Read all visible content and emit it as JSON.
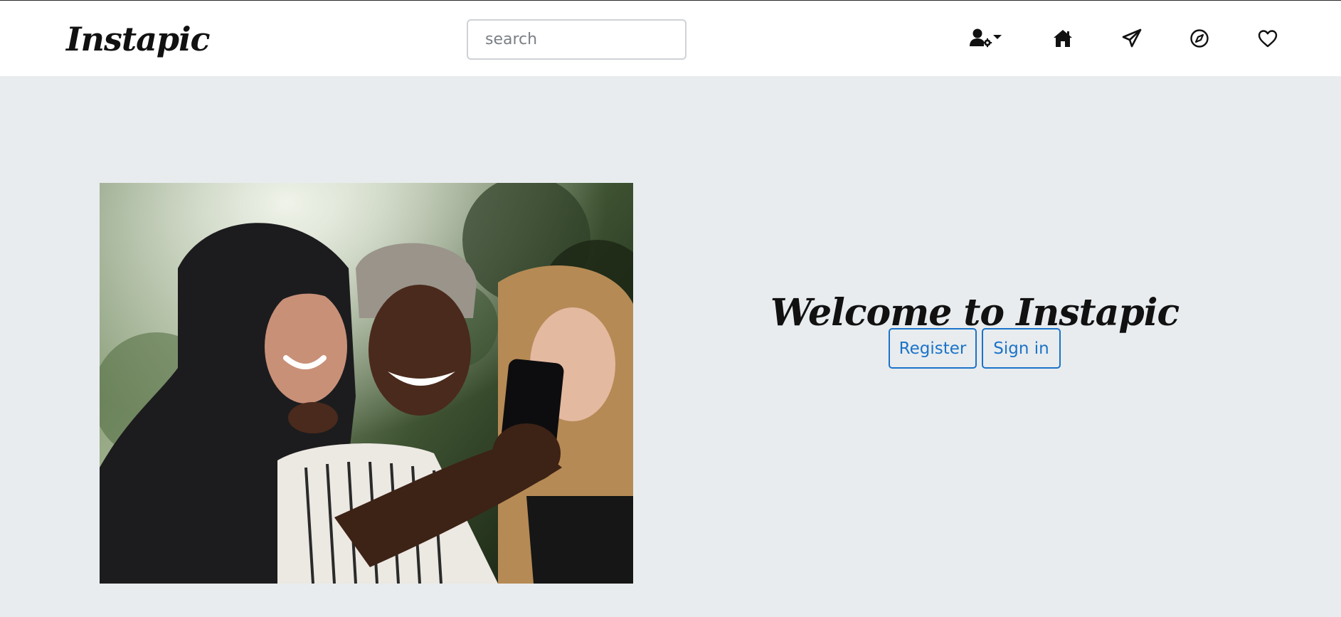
{
  "header": {
    "logo": "Instapic",
    "search": {
      "placeholder": "search",
      "value": ""
    },
    "icons": [
      "user-settings-dropdown-icon",
      "home-icon",
      "send-icon",
      "explore-icon",
      "heart-icon"
    ]
  },
  "main": {
    "hero_image": {
      "description": "three-women-taking-selfie-photo"
    },
    "welcome_title": "Welcome to Instapic",
    "register_label": "Register",
    "signin_label": "Sign in"
  },
  "colors": {
    "page_background": "#e8ecee",
    "header_background": "#ffffff",
    "accent": "#1a73c9",
    "text": "#111111"
  }
}
